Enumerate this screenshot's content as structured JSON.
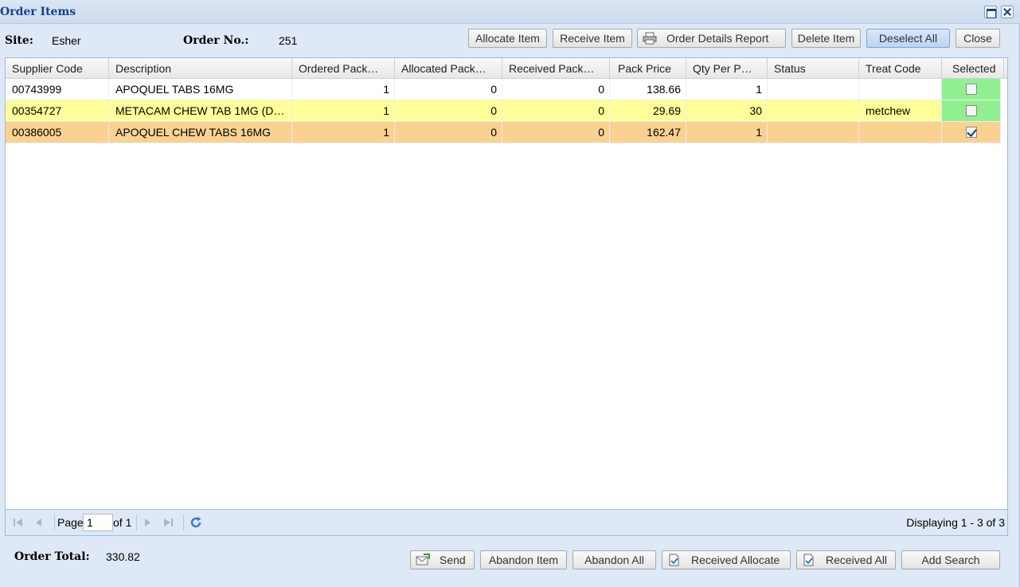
{
  "window": {
    "title": "Order Items"
  },
  "header": {
    "site_label": "Site:",
    "site_value": "Esher",
    "order_label": "Order No.:",
    "order_value": "251"
  },
  "toolbar": {
    "allocate_item": "Allocate Item",
    "receive_item": "Receive Item",
    "order_details_report": "Order Details Report",
    "delete_item": "Delete Item",
    "deselect_all": "Deselect All",
    "close": "Close"
  },
  "grid": {
    "columns": [
      "Supplier Code",
      "Description",
      "Ordered Pack…",
      "Allocated Pack…",
      "Received Pack…",
      "Pack Price",
      "Qty Per P…",
      "Status",
      "Treat Code",
      "Selected"
    ],
    "rows": [
      {
        "supplier_code": "00743999",
        "description": "APOQUEL TABS 16MG",
        "ordered": "1",
        "allocated": "0",
        "received": "0",
        "pack_price": "138.66",
        "qty_per_pack": "1",
        "status": "",
        "treat_code": "",
        "selected": false
      },
      {
        "supplier_code": "00354727",
        "description": "METACAM CHEW TAB 1MG (D…",
        "ordered": "1",
        "allocated": "0",
        "received": "0",
        "pack_price": "29.69",
        "qty_per_pack": "30",
        "status": "",
        "treat_code": "metchew",
        "selected": false
      },
      {
        "supplier_code": "00386005",
        "description": "APOQUEL CHEW TABS 16MG",
        "ordered": "1",
        "allocated": "0",
        "received": "0",
        "pack_price": "162.47",
        "qty_per_pack": "1",
        "status": "",
        "treat_code": "",
        "selected": true
      }
    ]
  },
  "pager": {
    "page_label": "Page",
    "page_value": "1",
    "of_label": "of 1",
    "display_info": "Displaying 1 - 3 of 3"
  },
  "footer": {
    "total_label": "Order Total:",
    "total_value": "330.82",
    "send": "Send",
    "abandon_item": "Abandon Item",
    "abandon_all": "Abandon All",
    "received_allocate": "Received Allocate",
    "received_all": "Received All",
    "add_search": "Add Search"
  },
  "colors": {
    "row_highlight_yellow": "#ffff99",
    "row_highlight_orange": "#f9d291",
    "selected_cell_green": "#90f090",
    "title_blue": "#15428b"
  }
}
